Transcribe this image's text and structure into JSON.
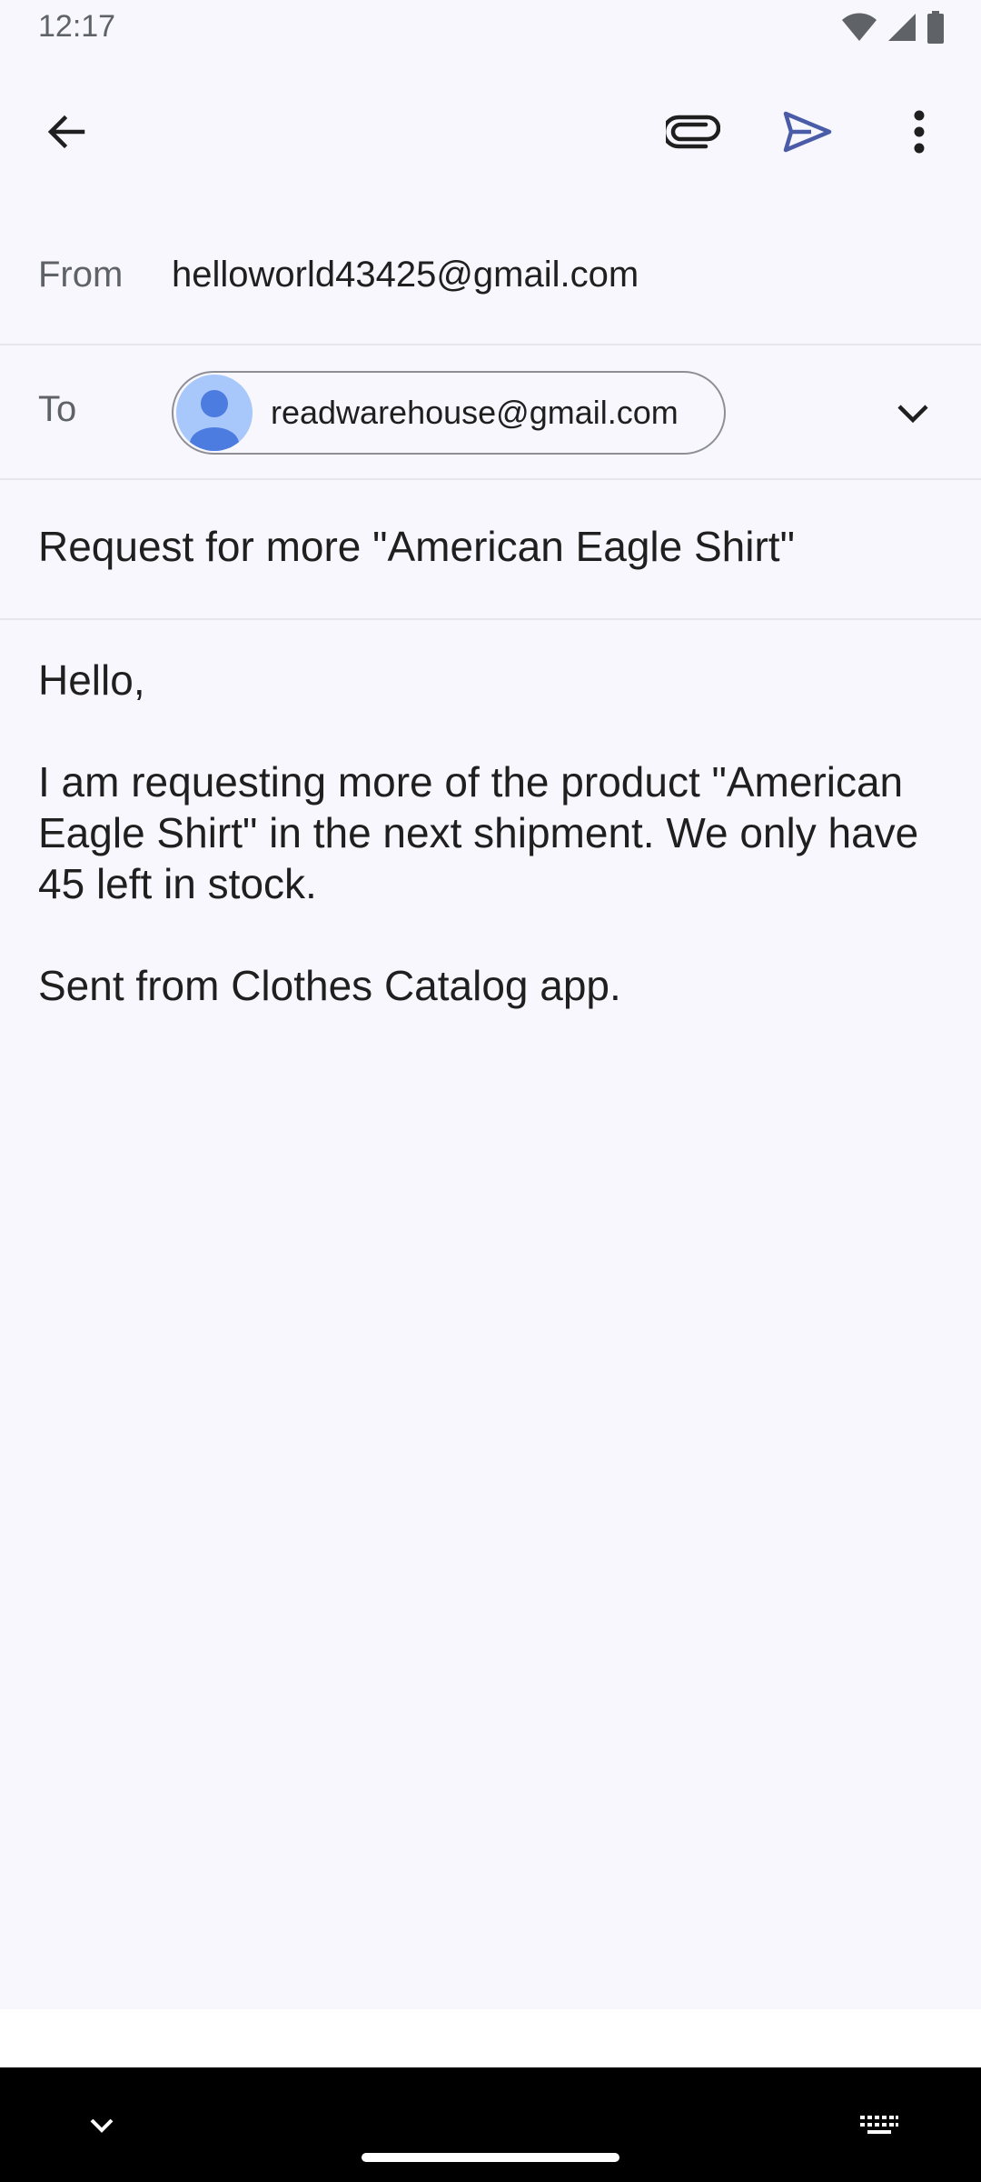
{
  "status_bar": {
    "time": "12:17",
    "icons": [
      "wifi-icon",
      "signal-icon",
      "battery-icon"
    ]
  },
  "toolbar": {
    "back_icon": "arrow-back-icon",
    "attach_icon": "paperclip-icon",
    "send_icon": "send-icon",
    "more_icon": "more-vert-icon"
  },
  "compose": {
    "from_label": "From",
    "from_value": "helloworld43425@gmail.com",
    "to_label": "To",
    "to_recipient": "readwarehouse@gmail.com",
    "subject": "Request for more \"American Eagle Shirt\"",
    "body_greeting": "Hello,",
    "body_message": "I am requesting more of the product \"American Eagle Shirt\" in the next shipment. We only have 45 left in stock.",
    "body_signature": "Sent from Clothes Catalog app."
  },
  "nav_bar": {
    "left_icon": "chevron-down-icon",
    "right_icon": "keyboard-icon"
  },
  "colors": {
    "background": "#f7f7fd",
    "send_accent": "#4a5ca8",
    "avatar_bg": "#a8c7fa",
    "avatar_fg": "#4c7ce0"
  }
}
